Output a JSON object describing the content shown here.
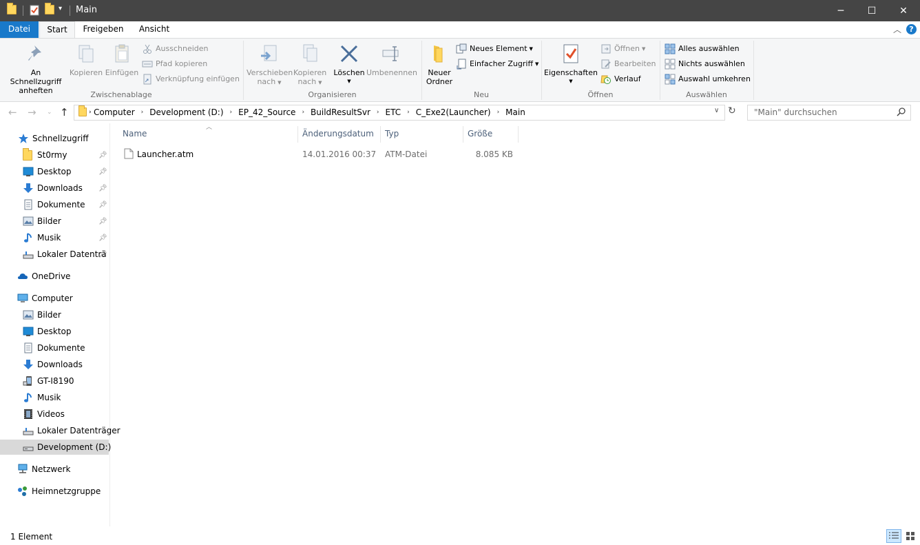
{
  "window": {
    "title": "Main",
    "minimize_label": "─",
    "maximize_label": "☐",
    "close_label": "✕"
  },
  "ribbon_tabs": [
    "Datei",
    "Start",
    "Freigeben",
    "Ansicht"
  ],
  "ribbon": {
    "zwischenablage": {
      "label": "Zwischenablage",
      "pin": "An Schnellzugriff anheften",
      "copy": "Kopieren",
      "paste": "Einfügen",
      "cut": "Ausschneiden",
      "copy_path": "Pfad kopieren",
      "paste_shortcut": "Verknüpfung einfügen"
    },
    "organisieren": {
      "label": "Organisieren",
      "move_to_1": "Verschieben",
      "move_to_2": "nach",
      "copy_to_1": "Kopieren",
      "copy_to_2": "nach",
      "delete": "Löschen",
      "rename": "Umbenennen"
    },
    "neu": {
      "label": "Neu",
      "new_folder_1": "Neuer",
      "new_folder_2": "Ordner",
      "new_item": "Neues Element",
      "easy_access": "Einfacher Zugriff"
    },
    "oeffnen": {
      "label": "Öffnen",
      "properties": "Eigenschaften",
      "open": "Öffnen",
      "edit": "Bearbeiten",
      "history": "Verlauf"
    },
    "auswaehlen": {
      "label": "Auswählen",
      "select_all": "Alles auswählen",
      "select_none": "Nichts auswählen",
      "invert": "Auswahl umkehren"
    }
  },
  "address": {
    "crumbs": [
      "Computer",
      "Development (D:)",
      "EP_42_Source",
      "BuildResultSvr",
      "ETC",
      "C_Exe2(Launcher)",
      "Main"
    ],
    "search_placeholder": "\"Main\" durchsuchen"
  },
  "sidebar": {
    "quick_access": {
      "label": "Schnellzugriff",
      "items": [
        "St0rmy",
        "Desktop",
        "Downloads",
        "Dokumente",
        "Bilder",
        "Musik",
        "Lokaler Datenträ"
      ]
    },
    "onedrive": "OneDrive",
    "computer": {
      "label": "Computer",
      "items": [
        "Bilder",
        "Desktop",
        "Dokumente",
        "Downloads",
        "GT-I8190",
        "Musik",
        "Videos",
        "Lokaler Datenträger",
        "Development (D:)"
      ]
    },
    "network": "Netzwerk",
    "homegroup": "Heimnetzgruppe"
  },
  "columns": [
    "Name",
    "Änderungsdatum",
    "Typ",
    "Größe"
  ],
  "files": [
    {
      "name": "Launcher.atm",
      "date": "14.01.2016 00:37",
      "type": "ATM-Datei",
      "size": "8.085 KB"
    }
  ],
  "status": {
    "count": "1 Element"
  },
  "colors": {
    "accent": "#1979ca",
    "titlebar": "#454545",
    "ribbon_bg": "#f5f6f7",
    "folder": "#ffd75e",
    "selected_nav": "#d9d9d9"
  }
}
